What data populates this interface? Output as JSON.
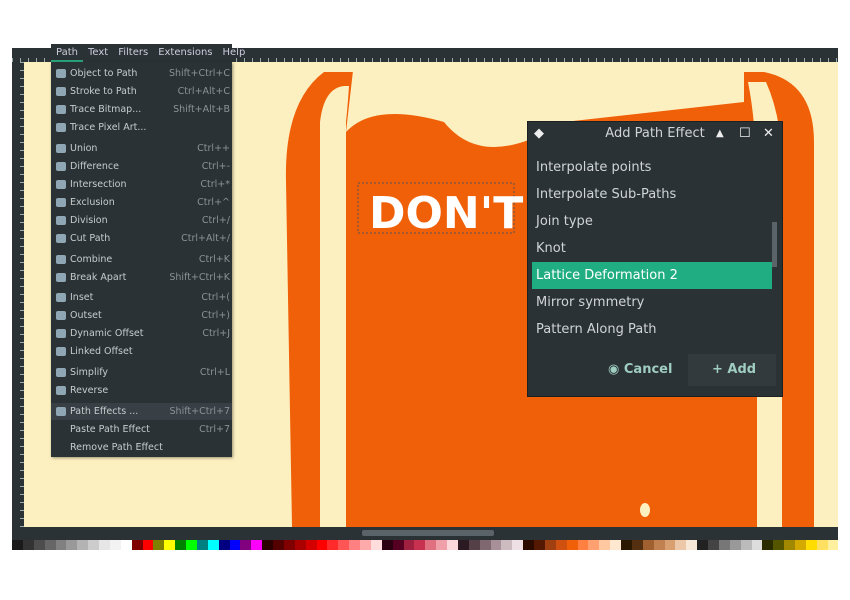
{
  "menubar": {
    "items": [
      "Path",
      "Text",
      "Filters",
      "Extensions",
      "Help"
    ]
  },
  "path_menu": {
    "items": [
      {
        "label": "Object to Path",
        "shortcut": "Shift+Ctrl+C",
        "icon": "object-to-path-icon"
      },
      {
        "label": "Stroke to Path",
        "shortcut": "Ctrl+Alt+C",
        "icon": "stroke-to-path-icon"
      },
      {
        "label": "Trace Bitmap...",
        "shortcut": "Shift+Alt+B",
        "icon": "trace-bitmap-icon"
      },
      {
        "label": "Trace Pixel Art...",
        "shortcut": "",
        "icon": "trace-pixel-art-icon"
      },
      {
        "label": "Union",
        "shortcut": "Ctrl++",
        "icon": "union-icon"
      },
      {
        "label": "Difference",
        "shortcut": "Ctrl+-",
        "icon": "difference-icon"
      },
      {
        "label": "Intersection",
        "shortcut": "Ctrl+*",
        "icon": "intersection-icon"
      },
      {
        "label": "Exclusion",
        "shortcut": "Ctrl+^",
        "icon": "exclusion-icon"
      },
      {
        "label": "Division",
        "shortcut": "Ctrl+/",
        "icon": "division-icon"
      },
      {
        "label": "Cut Path",
        "shortcut": "Ctrl+Alt+/",
        "icon": "cut-path-icon"
      },
      {
        "label": "Combine",
        "shortcut": "Ctrl+K",
        "icon": "combine-icon"
      },
      {
        "label": "Break Apart",
        "shortcut": "Shift+Ctrl+K",
        "icon": "break-apart-icon"
      },
      {
        "label": "Inset",
        "shortcut": "Ctrl+(",
        "icon": "inset-icon"
      },
      {
        "label": "Outset",
        "shortcut": "Ctrl+)",
        "icon": "outset-icon"
      },
      {
        "label": "Dynamic Offset",
        "shortcut": "Ctrl+J",
        "icon": "dynamic-offset-icon"
      },
      {
        "label": "Linked Offset",
        "shortcut": "",
        "icon": "linked-offset-icon"
      },
      {
        "label": "Simplify",
        "shortcut": "Ctrl+L",
        "icon": "simplify-icon"
      },
      {
        "label": "Reverse",
        "shortcut": "",
        "icon": "reverse-icon"
      },
      {
        "label": "Path Effects ...",
        "shortcut": "Shift+Ctrl+7",
        "icon": "path-effects-icon"
      },
      {
        "label": "Paste Path Effect",
        "shortcut": "Ctrl+7",
        "icon": ""
      },
      {
        "label": "Remove Path Effect",
        "shortcut": "",
        "icon": ""
      }
    ]
  },
  "canvas": {
    "text": "DON'T",
    "colors": {
      "background": "#fdf0c0",
      "orange": "#f06008"
    }
  },
  "dialog": {
    "title": "Add Path Effect",
    "items": [
      "Interpolate points",
      "Interpolate Sub-Paths",
      "Join type",
      "Knot",
      "Lattice Deformation 2",
      "Mirror symmetry",
      "Pattern Along Path"
    ],
    "selected": "Lattice Deformation 2",
    "cancel": "Cancel",
    "add": "Add",
    "accent": "#21ad82"
  },
  "palette": [
    "#1a1a1a",
    "#333",
    "#4d4d4d",
    "#666",
    "#808080",
    "#999",
    "#b3b3b3",
    "#ccc",
    "#e6e6e6",
    "#f2f2f2",
    "#fff",
    "#800000",
    "#f00",
    "#808000",
    "#ff0",
    "#008000",
    "#0f0",
    "#008080",
    "#0ff",
    "#000080",
    "#00f",
    "#800080",
    "#f0f",
    "#2b0000",
    "#550000",
    "#800000",
    "#aa0000",
    "#d40000",
    "#f00",
    "#ff2a2a",
    "#f55",
    "#ff8080",
    "#faa",
    "#fdd",
    "#2b0011",
    "#550022",
    "#a02040",
    "#c83050",
    "#e07080",
    "#f0a0a8",
    "#fbd8dc",
    "#2b1a22",
    "#554048",
    "#806870",
    "#a89098",
    "#ccbcc0",
    "#eee0e4",
    "#2b0a00",
    "#551800",
    "#a04010",
    "#d05010",
    "#f06008",
    "#ff8040",
    "#ffa070",
    "#ffc8a0",
    "#ffe8d0",
    "#2b1800",
    "#553010",
    "#a06030",
    "#c08050",
    "#d8a070",
    "#ecc8a8",
    "#f8e8d8",
    "#222",
    "#444",
    "#777",
    "#999",
    "#bbb",
    "#ddd",
    "#2b2b00",
    "#555500",
    "#a08800",
    "#d4aa00",
    "#fd0",
    "#ffe060",
    "#fff0a0"
  ]
}
